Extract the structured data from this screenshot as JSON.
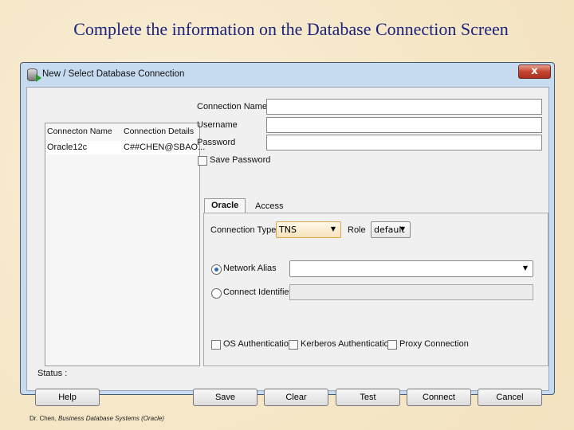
{
  "slide": {
    "title": "Complete the information on the Database Connection Screen",
    "footer_author": "Dr. Chen, ",
    "footer_course": "Business Database Systems (Oracle)"
  },
  "dialog": {
    "title": "New / Select Database Connection",
    "close_label": "x",
    "list": {
      "columns": [
        "Connecton Name",
        "Connection Details"
      ],
      "rows": [
        {
          "name": "Oracle12c",
          "details": "C##CHEN@SBAO..."
        }
      ]
    },
    "fields": {
      "connection_name_label": "Connection Name",
      "connection_name_value": "",
      "username_label": "Username",
      "username_value": "",
      "password_label": "Password",
      "password_value": "",
      "save_password_label": "Save Password",
      "save_password_checked": false
    },
    "tabs": [
      {
        "label": "Oracle",
        "active": true
      },
      {
        "label": "Access",
        "active": false
      }
    ],
    "oracle": {
      "connection_type_label": "Connection Type",
      "connection_type_value": "TNS",
      "role_label": "Role",
      "role_value": "default",
      "network_alias_label": "Network Alias",
      "network_alias_value": "",
      "network_alias_selected": true,
      "connect_identifier_label": "Connect Identifier",
      "connect_identifier_value": "",
      "os_auth_label": "OS Authentication",
      "kerberos_label": "Kerberos Authentication",
      "proxy_label": "Proxy Connection"
    },
    "status_label": "Status :",
    "buttons": {
      "help": "Help",
      "save": "Save",
      "clear": "Clear",
      "test": "Test",
      "connect": "Connect",
      "cancel": "Cancel"
    }
  }
}
